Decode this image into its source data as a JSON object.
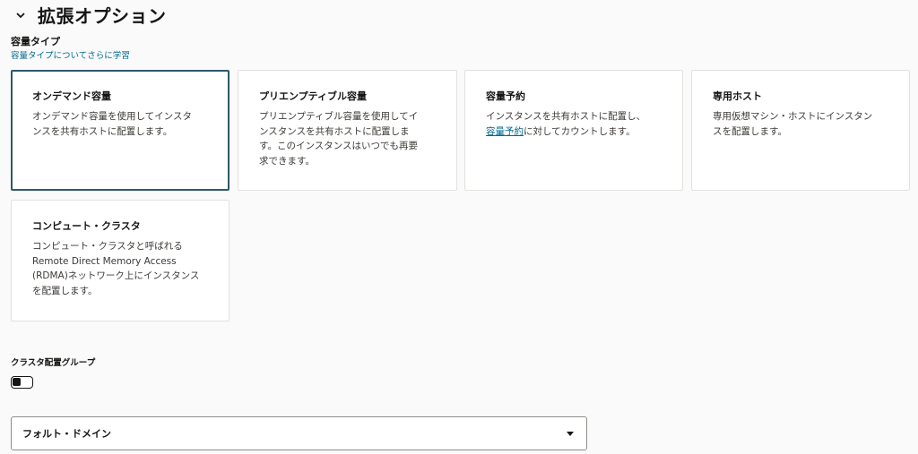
{
  "section": {
    "title": "拡張オプション",
    "expanded": true
  },
  "capacity_type": {
    "label": "容量タイプ",
    "learn_more": "容量タイプについてさらに学習",
    "selected": "on_demand",
    "cards": [
      {
        "id": "on_demand",
        "title": "オンデマンド容量",
        "description": [
          "オンデマンド容量を使用してインスタ",
          "ンスを共有ホストに配置します。"
        ]
      },
      {
        "id": "preemptible",
        "title": "プリエンプティブル容量",
        "description": [
          "プリエンプティブル容量を使用してイ",
          "ンスタンスを共有ホストに配置しま",
          "す。このインスタンスはいつでも再要",
          "求できます。"
        ]
      },
      {
        "id": "reservation",
        "title": "容量予約",
        "description_line1": "インスタンスを共有ホストに配置し、",
        "description_link": "容量予約",
        "description_suffix": "に対してカウントします。"
      },
      {
        "id": "dedicated_host",
        "title": "専用ホスト",
        "description": [
          "専用仮想マシン・ホストにインスタン",
          "スを配置します。"
        ]
      },
      {
        "id": "compute_cluster",
        "title": "コンピュート・クラスタ",
        "description": [
          "コンピュート・クラスタと呼ばれる",
          "Remote Direct Memory Access",
          "(RDMA)ネットワーク上にインスタンス",
          "を配置します。"
        ]
      }
    ]
  },
  "cluster_placement_group": {
    "label": "クラスタ配置グループ",
    "enabled": false
  },
  "fault_domain": {
    "value": "フォルト・ドメイン"
  },
  "colors": {
    "accent": "#2c5967",
    "link": "#00688c"
  }
}
